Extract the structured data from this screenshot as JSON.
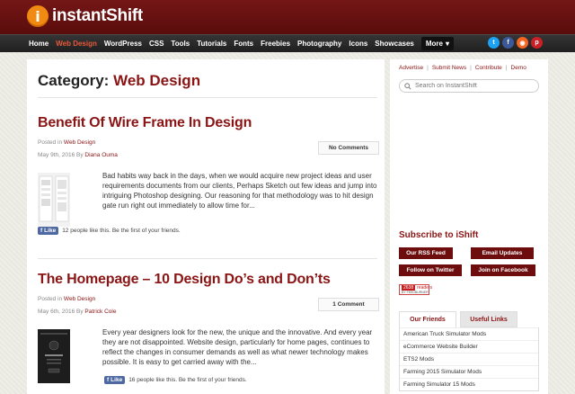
{
  "brand": {
    "logo_mark": "i",
    "name": "instantShift"
  },
  "nav": {
    "items": [
      "Home",
      "Web Design",
      "WordPress",
      "CSS",
      "Tools",
      "Tutorials",
      "Fonts",
      "Freebies",
      "Photography",
      "Icons",
      "Showcases"
    ],
    "active_index": 1,
    "more_label": "More",
    "social": [
      {
        "icon": "twitter-icon",
        "glyph": "t",
        "color": "#1da1f2"
      },
      {
        "icon": "facebook-icon",
        "glyph": "f",
        "color": "#3b5998"
      },
      {
        "icon": "rss-icon",
        "glyph": "◉",
        "color": "#f26522"
      },
      {
        "icon": "pinterest-icon",
        "glyph": "p",
        "color": "#cb2027"
      }
    ]
  },
  "main": {
    "category_prefix": "Category:",
    "category_name": "Web Design",
    "posts": [
      {
        "title": "Benefit Of Wire Frame In Design",
        "posted_in_prefix": "Posted in",
        "category": "Web Design",
        "date": "May 9th, 2016 By",
        "author": "Diana Ouma",
        "comments": "No Comments",
        "excerpt": "Bad habits way back in the days, when we would acquire new project ideas and user requirements documents from our clients, Perhaps Sketch out few ideas and jump into intriguing Photoshop designing. Our reasoning for that methodology was to hit design gate run right out immediately to allow time for...",
        "like_label": "Like",
        "like_text": "12 people like this. Be the first of your friends."
      },
      {
        "title": "The Homepage – 10 Design Do’s and Don’ts",
        "posted_in_prefix": "Posted in",
        "category": "Web Design",
        "date": "May 6th, 2016 By",
        "author": "Patrick Cole",
        "comments": "1 Comment",
        "excerpt": "Every year designers look for the new, the unique and the innovative. And every year they are not disappointed. Website design, particularly for home pages, continues to reflect the changes in consumer demands as well as what newer technology makes possible. It is easy to get carried away with the...",
        "like_label": "Like",
        "like_text": "16 people like this. Be the first of your friends."
      }
    ]
  },
  "sidebar": {
    "top_links": [
      "Advertise",
      "Submit News",
      "Contribute",
      "Demo"
    ],
    "search_placeholder": "Search on InstantShift",
    "subscribe_title": "Subscribe to iShift",
    "subscribe_buttons": [
      "Our RSS Feed",
      "Email Updates",
      "Follow on Twitter",
      "Join on Facebook"
    ],
    "reader_badge": {
      "count": "2638",
      "label": "readers",
      "by": "BY FEEDBURNER"
    },
    "tabs": [
      "Our Friends",
      "Useful Links"
    ],
    "friends": [
      "American Truck Simulator Mods",
      "eCommerce Website Builder",
      "ETS2 Mods",
      "Farming 2015 Simulator Mods",
      "Farming Simulator 15 Mods"
    ]
  }
}
